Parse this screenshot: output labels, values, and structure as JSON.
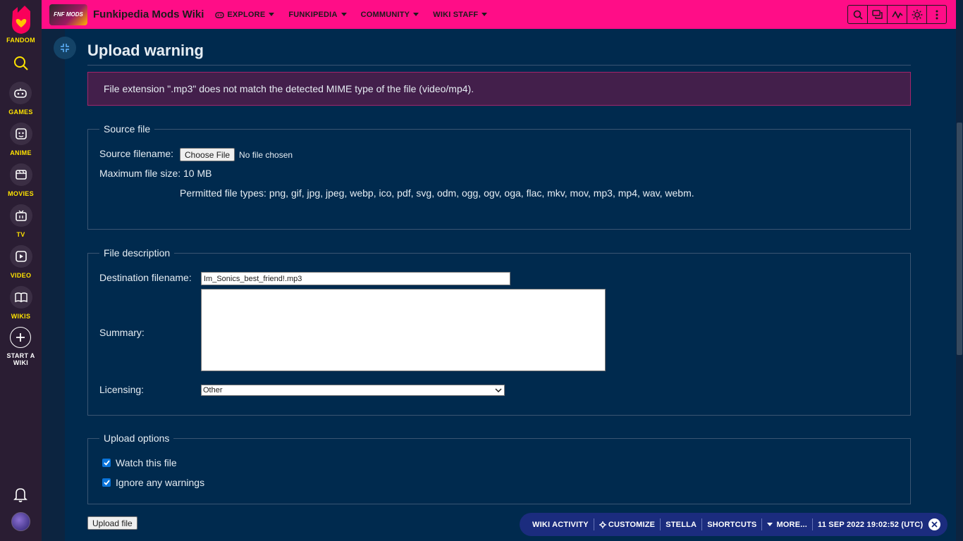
{
  "global_nav": {
    "brand_label": "FANDOM",
    "items": [
      {
        "label": "GAMES",
        "icon": "controller-icon"
      },
      {
        "label": "ANIME",
        "icon": "anime-face-icon"
      },
      {
        "label": "MOVIES",
        "icon": "clapperboard-icon"
      },
      {
        "label": "TV",
        "icon": "tv-icon"
      },
      {
        "label": "VIDEO",
        "icon": "play-icon"
      },
      {
        "label": "WIKIS",
        "icon": "book-icon"
      }
    ],
    "start_wiki_line1": "START A",
    "start_wiki_line2": "WIKI"
  },
  "header": {
    "logo_text": "FNF MODS",
    "wiki_name": "Funkipedia Mods Wiki",
    "nav": [
      {
        "label": "EXPLORE"
      },
      {
        "label": "FUNKIPEDIA"
      },
      {
        "label": "COMMUNITY"
      },
      {
        "label": "WIKI STAFF"
      }
    ],
    "accent_color": "#ff0d87"
  },
  "page": {
    "title": "Upload warning",
    "error_message": "File extension \".mp3\" does not match the detected MIME type of the file (video/mp4).",
    "source_file": {
      "legend": "Source file",
      "filename_label": "Source filename:",
      "choose_button": "Choose File",
      "no_file_text": "No file chosen",
      "max_size": "Maximum file size: 10 MB",
      "permitted": "Permitted file types: png, gif, jpg, jpeg, webp, ico, pdf, svg, odm, ogg, ogv, oga, flac, mkv, mov, mp3, mp4, wav, webm."
    },
    "file_description": {
      "legend": "File description",
      "destination_label": "Destination filename:",
      "destination_value": "Im_Sonics_best_friend!.mp3",
      "summary_label": "Summary:",
      "licensing_label": "Licensing:",
      "licensing_value": "Other"
    },
    "upload_options": {
      "legend": "Upload options",
      "watch_label": "Watch this file",
      "ignore_label": "Ignore any warnings"
    },
    "upload_button": "Upload file"
  },
  "toolbar": {
    "wiki_activity": "WIKI ACTIVITY",
    "customize": "CUSTOMIZE",
    "user": "STELLA",
    "shortcuts": "SHORTCUTS",
    "more": "MORE...",
    "timestamp": "11 SEP 2022 19:02:52 (UTC)"
  }
}
